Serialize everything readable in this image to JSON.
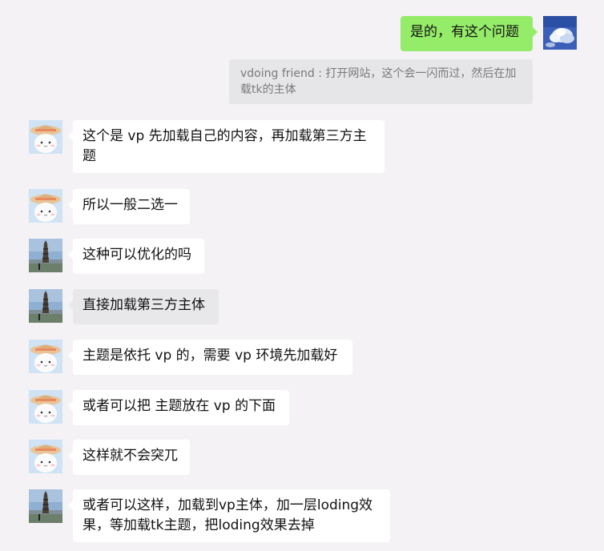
{
  "messages": [
    {
      "sender": "me",
      "text": "是的，有这个问题"
    },
    {
      "sender": "quote",
      "text": "vdoing friend : 打开网站，这个会一闪而过，然后在加载tk的主体"
    },
    {
      "sender": "friend",
      "avatar": "hat-avatar",
      "text": "这个是 vp 先加载自己的内容，再加载第三方主题"
    },
    {
      "sender": "friend",
      "avatar": "hat-avatar",
      "text": "所以一般二选一"
    },
    {
      "sender": "other",
      "avatar": "tower-avatar",
      "text": "这种可以优化的吗"
    },
    {
      "sender": "other",
      "avatar": "tower-avatar",
      "text": "直接加载第三方主体",
      "selected": true
    },
    {
      "sender": "friend",
      "avatar": "hat-avatar",
      "text": "主题是依托 vp 的，需要 vp 环境先加载好"
    },
    {
      "sender": "friend",
      "avatar": "hat-avatar",
      "text": "或者可以把 主题放在 vp 的下面"
    },
    {
      "sender": "friend",
      "avatar": "hat-avatar",
      "text": "这样就不会突兀"
    },
    {
      "sender": "other",
      "avatar": "tower-avatar",
      "text": "或者可以这样，加载到vp主体，加一层loding效果，等加载tk主题，把loding效果去掉"
    }
  ],
  "colors": {
    "background": "#f4f2f5",
    "my_bubble": "#95ec69",
    "their_bubble": "#ffffff",
    "selected_bubble": "#e8e7ea",
    "quote_bg": "#e6e5e8",
    "quote_text": "#7a7a7a"
  }
}
